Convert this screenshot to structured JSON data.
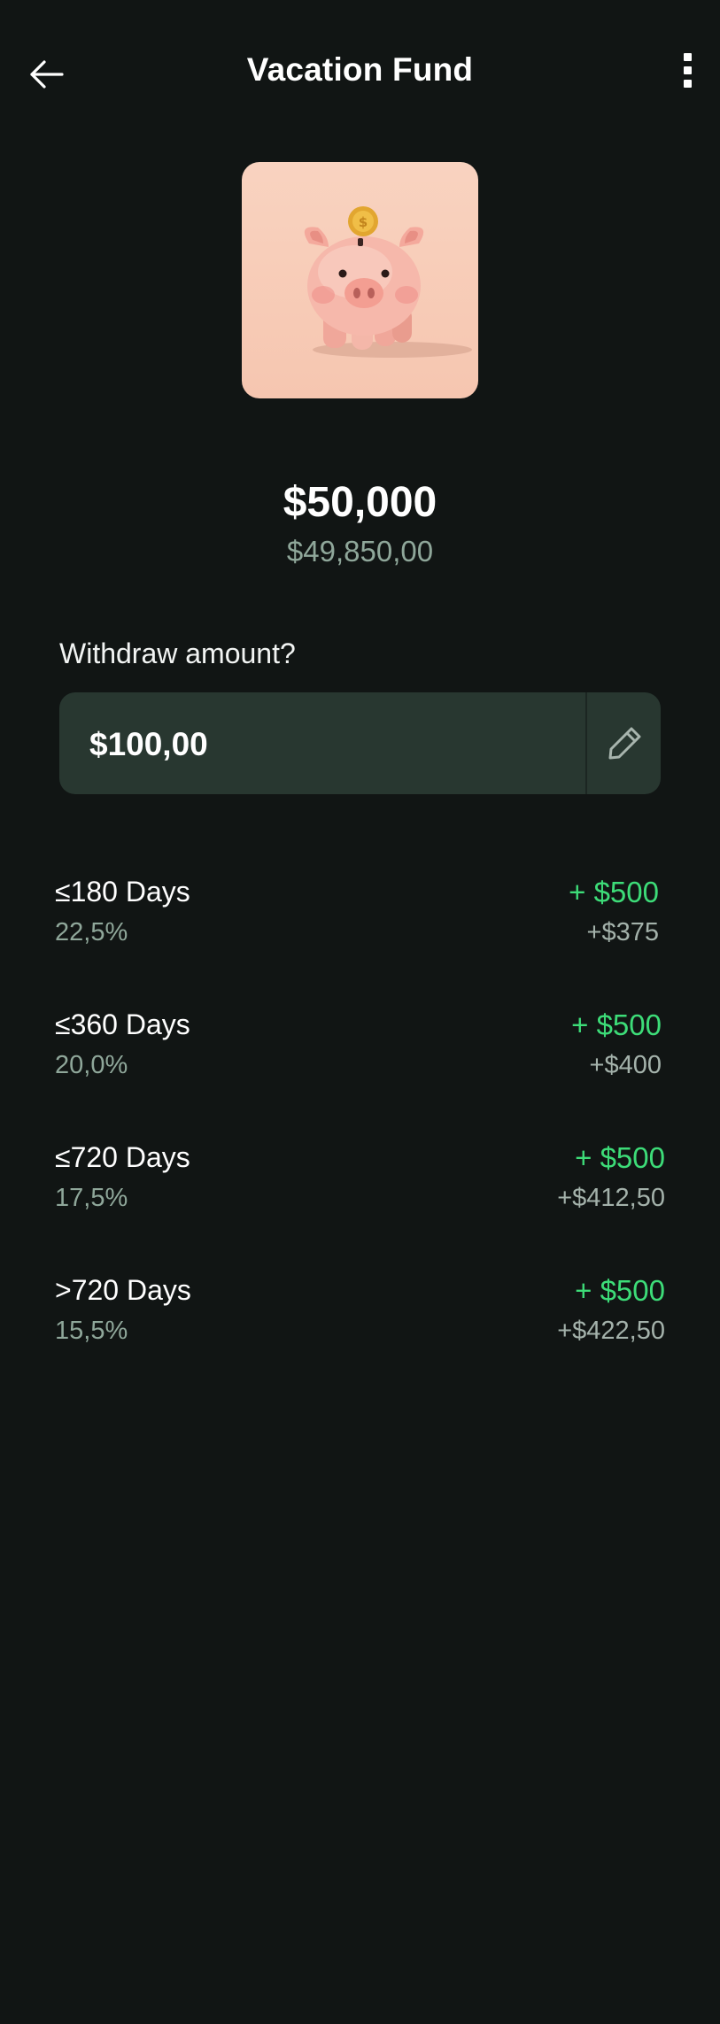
{
  "header": {
    "title": "Vacation Fund",
    "back_icon": "arrow-left-icon",
    "more_icon": "more-vertical-icon"
  },
  "image": {
    "subject": "piggy-bank-with-coin",
    "background_color": "#f8cdb8"
  },
  "balance": {
    "amount": "$50,000",
    "available": "$49,850,00"
  },
  "withdraw": {
    "label": "Withdraw amount?",
    "value": "$100,00",
    "edit_icon": "pencil-icon"
  },
  "tiers": [
    {
      "label": "≤180 Days",
      "rate": "22,5%",
      "bonus": "+ $500",
      "earn": "+$375"
    },
    {
      "label": "≤360 Days",
      "rate": "20,0%",
      "bonus": "+ $500",
      "earn": "+$400"
    },
    {
      "label": "≤720 Days",
      "rate": "17,5%",
      "bonus": "+ $500",
      "earn": "+$412,50"
    },
    {
      "label": ">720 Days",
      "rate": "15,5%",
      "bonus": "+ $500",
      "earn": "+$422,50"
    }
  ],
  "colors": {
    "background": "#111514",
    "field": "#283730",
    "accent_green": "#3ddc78",
    "muted_text": "#8fa79a"
  }
}
